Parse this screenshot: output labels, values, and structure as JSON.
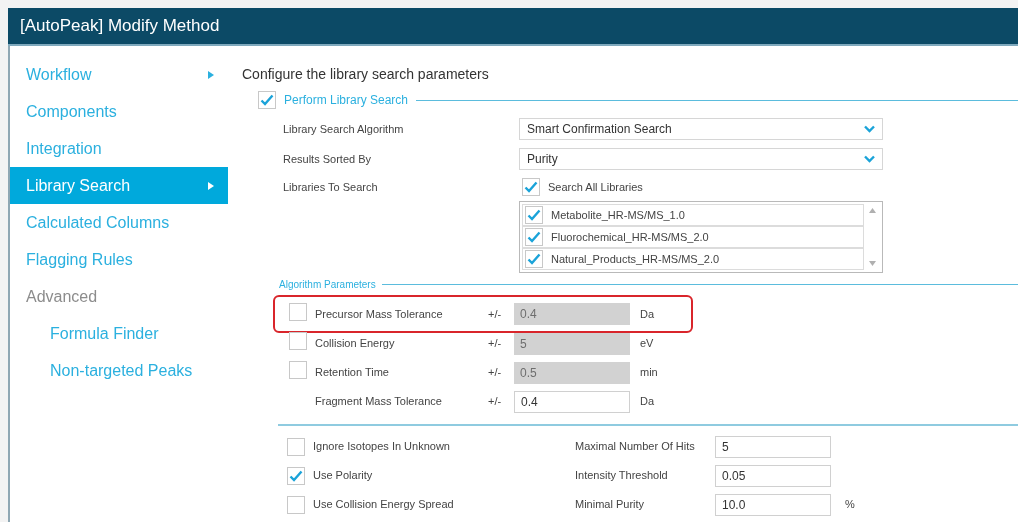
{
  "window": {
    "title": "[AutoPeak] Modify Method"
  },
  "sidebar": {
    "items": [
      {
        "label": "Workflow",
        "selected": false,
        "disabled": false,
        "submenu": true
      },
      {
        "label": "Components",
        "selected": false,
        "disabled": false,
        "submenu": false
      },
      {
        "label": "Integration",
        "selected": false,
        "disabled": false,
        "submenu": false
      },
      {
        "label": "Library Search",
        "selected": true,
        "disabled": false,
        "submenu": true
      },
      {
        "label": "Calculated Columns",
        "selected": false,
        "disabled": false,
        "submenu": false
      },
      {
        "label": "Flagging Rules",
        "selected": false,
        "disabled": false,
        "submenu": false
      },
      {
        "label": "Advanced",
        "selected": false,
        "disabled": true,
        "submenu": false,
        "children": [
          {
            "label": "Formula Finder",
            "selected": false,
            "disabled": false,
            "submenu": false
          },
          {
            "label": "Non-targeted Peaks",
            "selected": false,
            "disabled": false,
            "submenu": false
          }
        ]
      }
    ]
  },
  "main": {
    "heading": "Configure the library search parameters",
    "perform_library_search": {
      "label": "Perform Library Search",
      "checked": true
    },
    "fields": [
      {
        "kind": "dropdown",
        "label": "Library Search Algorithm",
        "value": "Smart Confirmation Search"
      },
      {
        "kind": "dropdown",
        "label": "Results Sorted By",
        "value": "Purity"
      },
      {
        "kind": "library_list",
        "label": "Libraries To Search",
        "search_all": {
          "label": "Search All Libraries",
          "checked": true
        },
        "libraries": [
          {
            "name": "Metabolite_HR-MS/MS_1.0",
            "checked": true
          },
          {
            "name": "Fluorochemical_HR-MS/MS_2.0",
            "checked": true
          },
          {
            "name": "Natural_Products_HR-MS/MS_2.0",
            "checked": true
          }
        ]
      }
    ],
    "algorithm_parameters": {
      "title": "Algorithm Parameters",
      "params": [
        {
          "kind": "checkbox",
          "label": "Precursor Mass Tolerance",
          "checked": false,
          "sign": "+/-",
          "value": "0.4",
          "disabled": true,
          "unit": "Da",
          "highlighted": true
        },
        {
          "kind": "checkbox",
          "label": "Collision Energy",
          "checked": false,
          "sign": "+/-",
          "value": "5",
          "disabled": true,
          "unit": "eV",
          "highlighted": false
        },
        {
          "kind": "checkbox",
          "label": "Retention Time",
          "checked": false,
          "sign": "+/-",
          "value": "0.5",
          "disabled": true,
          "unit": "min",
          "highlighted": false
        },
        {
          "kind": "plain",
          "label": "Fragment Mass Tolerance",
          "sign": "+/-",
          "value": "0.4",
          "disabled": false,
          "unit": "Da",
          "highlighted": false
        }
      ]
    },
    "options": [
      {
        "label": "Ignore Isotopes In Unknown",
        "checked": false
      },
      {
        "label": "Use Polarity",
        "checked": true
      },
      {
        "label": "Use Collision Energy Spread",
        "checked": false
      }
    ],
    "settings": [
      {
        "label": "Maximal Number Of Hits",
        "value": "5"
      },
      {
        "label": "Intensity Threshold",
        "value": "0.05"
      },
      {
        "label": "Minimal Purity",
        "value": "10.0",
        "unit": "%"
      }
    ]
  }
}
